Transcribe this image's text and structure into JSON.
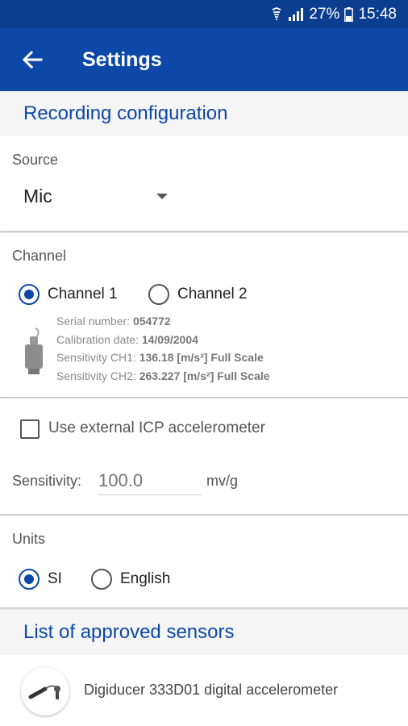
{
  "status_bar": {
    "battery": "27%",
    "time": "15:48"
  },
  "app_bar": {
    "title": "Settings"
  },
  "recording": {
    "header": "Recording configuration",
    "source": {
      "label": "Source",
      "value": "Mic"
    },
    "channel": {
      "label": "Channel",
      "options": [
        "Channel 1",
        "Channel 2"
      ],
      "selected": "Channel 1",
      "info": {
        "serial_label": "Serial number:",
        "serial_value": "054772",
        "calib_label": "Calibration date:",
        "calib_value": "14/09/2004",
        "sens1_label": "Sensitivity CH1:",
        "sens1_value": "136.18 [m/s²] Full Scale",
        "sens2_label": "Sensitivity CH2:",
        "sens2_value": "263.227 [m/s²] Full Scale"
      }
    },
    "external": {
      "checkbox_label": "Use external ICP accelerometer",
      "checked": false,
      "sensitivity_label": "Sensitivity:",
      "sensitivity_placeholder": "100.0",
      "sensitivity_unit": "mv/g"
    },
    "units": {
      "label": "Units",
      "options": [
        "SI",
        "English"
      ],
      "selected": "SI"
    }
  },
  "approved": {
    "header": "List of approved sensors",
    "items": [
      {
        "name": "Digiducer 333D01 digital accelerometer",
        "icon": "accelerometer-icon"
      }
    ]
  },
  "colors": {
    "primary": "#0d48a8",
    "status_bar": "#0b3e8f"
  }
}
